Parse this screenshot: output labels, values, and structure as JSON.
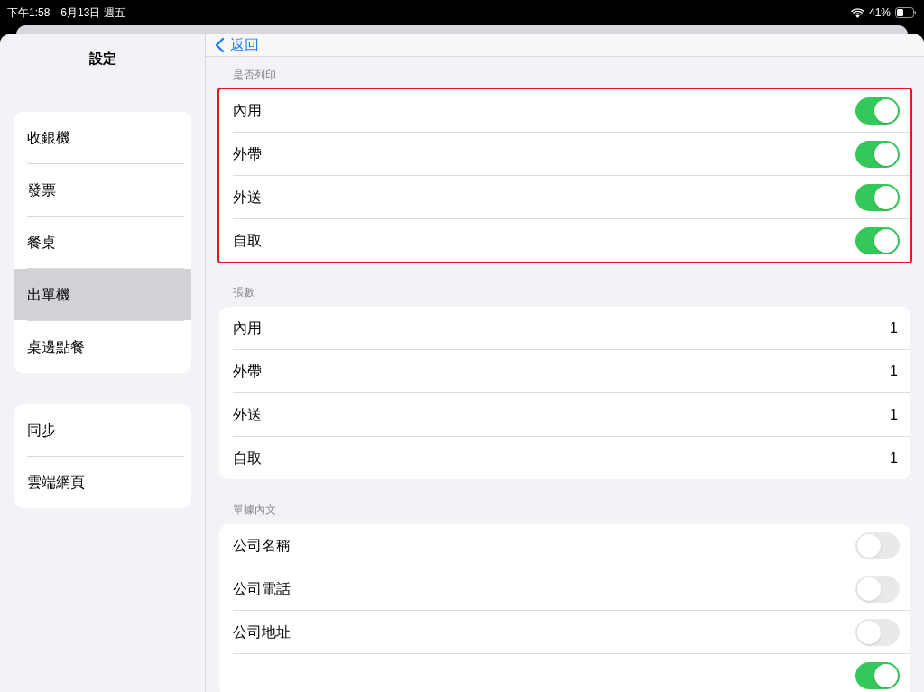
{
  "status_bar": {
    "time": "下午1:58",
    "date": "6月13日 週五",
    "battery_percent": "41%"
  },
  "sidebar": {
    "title": "設定",
    "groups": [
      [
        {
          "label": "收銀機",
          "selected": false
        },
        {
          "label": "發票",
          "selected": false
        },
        {
          "label": "餐桌",
          "selected": false
        },
        {
          "label": "出單機",
          "selected": true
        },
        {
          "label": "桌邊點餐",
          "selected": false
        }
      ],
      [
        {
          "label": "同步",
          "selected": false
        },
        {
          "label": "雲端網頁",
          "selected": false
        }
      ]
    ]
  },
  "nav": {
    "back": "返回"
  },
  "sections": [
    {
      "header": "是否列印",
      "highlighted": true,
      "rows": [
        {
          "kind": "toggle",
          "label": "內用",
          "on": true
        },
        {
          "kind": "toggle",
          "label": "外帶",
          "on": true
        },
        {
          "kind": "toggle",
          "label": "外送",
          "on": true
        },
        {
          "kind": "toggle",
          "label": "自取",
          "on": true
        }
      ]
    },
    {
      "header": "張數",
      "highlighted": false,
      "rows": [
        {
          "kind": "value",
          "label": "內用",
          "value": "1"
        },
        {
          "kind": "value",
          "label": "外帶",
          "value": "1"
        },
        {
          "kind": "value",
          "label": "外送",
          "value": "1"
        },
        {
          "kind": "value",
          "label": "自取",
          "value": "1"
        }
      ]
    },
    {
      "header": "單據內文",
      "highlighted": false,
      "rows": [
        {
          "kind": "toggle",
          "label": "公司名稱",
          "on": false
        },
        {
          "kind": "toggle",
          "label": "公司電話",
          "on": false
        },
        {
          "kind": "toggle",
          "label": "公司地址",
          "on": false
        },
        {
          "kind": "toggle",
          "on": true
        }
      ]
    }
  ]
}
